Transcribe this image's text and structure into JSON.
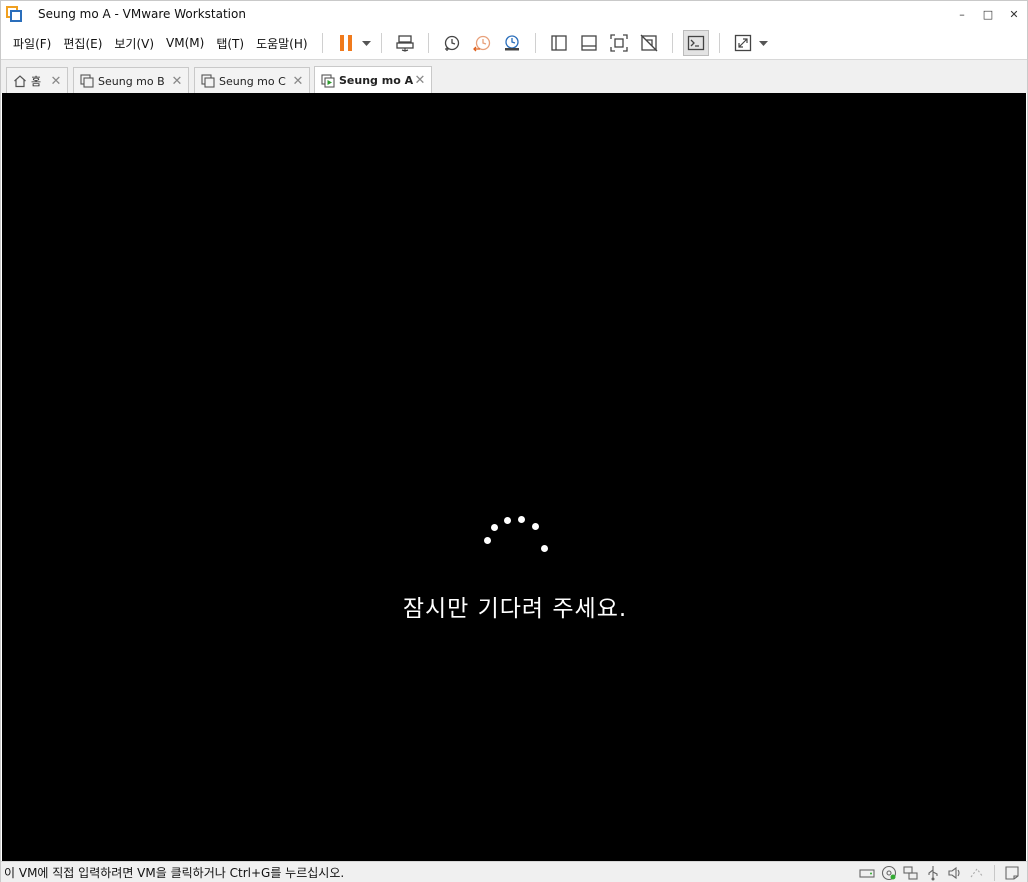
{
  "window": {
    "title": "Seung mo A - VMware Workstation",
    "controls": {
      "minimize": "–",
      "maximize": "□",
      "close": "✕"
    }
  },
  "menu": {
    "items": [
      "파일(F)",
      "편집(E)",
      "보기(V)",
      "VM(M)",
      "탭(T)",
      "도움말(H)"
    ]
  },
  "colors": {
    "accent_orange": "#f07a1c",
    "brand_blue": "#2a6ebb",
    "console_bg": "#000000"
  },
  "tabs": [
    {
      "label": "홈",
      "icon": "home-icon",
      "active": false
    },
    {
      "label": "Seung mo B",
      "icon": "vm-icon",
      "active": false
    },
    {
      "label": "Seung mo C",
      "icon": "vm-icon",
      "active": false
    },
    {
      "label": "Seung mo A",
      "icon": "vm-running-icon",
      "active": true
    }
  ],
  "tab_close": "✕",
  "console": {
    "message": "잠시만 기다려 주세요."
  },
  "statusbar": {
    "hint": "이 VM에 직접 입력하려면 VM을 클릭하거나 Ctrl+G를 누르십시오."
  }
}
